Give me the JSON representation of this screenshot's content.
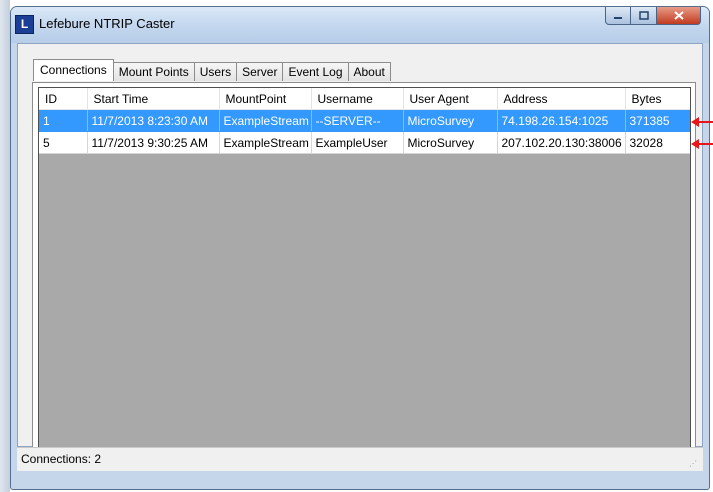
{
  "window": {
    "title": "Lefebure NTRIP Caster",
    "icon_letter": "L",
    "controls": [
      "minimize-icon",
      "maximize-icon",
      "close-icon"
    ]
  },
  "tabs": [
    {
      "label": "Connections",
      "active": true
    },
    {
      "label": "Mount Points",
      "active": false
    },
    {
      "label": "Users",
      "active": false
    },
    {
      "label": "Server",
      "active": false
    },
    {
      "label": "Event Log",
      "active": false
    },
    {
      "label": "About",
      "active": false
    }
  ],
  "table": {
    "columns": [
      "ID",
      "Start Time",
      "MountPoint",
      "Username",
      "User Agent",
      "Address",
      "Bytes"
    ],
    "rows": [
      {
        "selected": true,
        "cells": [
          "1",
          "11/7/2013 8:23:30 AM",
          "ExampleStream",
          "--SERVER--",
          "MicroSurvey",
          "74.198.26.154:1025",
          "371385"
        ]
      },
      {
        "selected": false,
        "cells": [
          "5",
          "11/7/2013 9:30:25 AM",
          "ExampleStream",
          "ExampleUser",
          "MicroSurvey",
          "207.102.20.130:38006",
          "32028"
        ]
      }
    ]
  },
  "status": {
    "text": "Connections: 2"
  },
  "colors": {
    "selection": "#3399ff",
    "list_background": "#a9a9a9",
    "annotation_arrow": "#e8161b"
  }
}
